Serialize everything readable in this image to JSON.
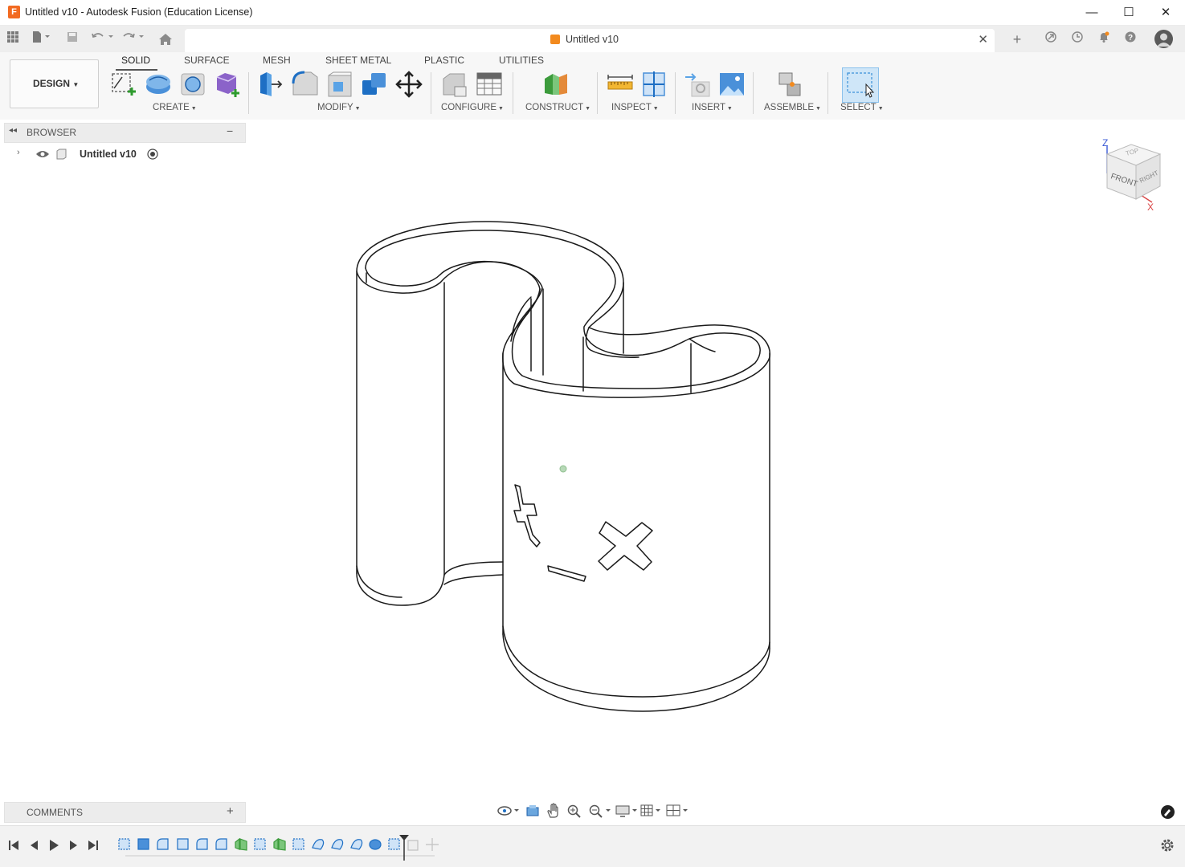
{
  "window": {
    "logo_letter": "F",
    "title": "Untitled v10 - Autodesk Fusion (Education License)",
    "minimize": "—",
    "maximize": "☐",
    "close": "✕"
  },
  "document_tab": {
    "label": "Untitled v10",
    "close": "✕"
  },
  "toolbar": {
    "workspace": "DESIGN",
    "tabs": [
      "SOLID",
      "SURFACE",
      "MESH",
      "SHEET METAL",
      "PLASTIC",
      "UTILITIES"
    ],
    "active_tab": "SOLID",
    "groups": [
      "CREATE",
      "MODIFY",
      "CONFIGURE",
      "CONSTRUCT",
      "INSPECT",
      "INSERT",
      "ASSEMBLE",
      "SELECT"
    ],
    "accent_blue": "#1e7bd6",
    "accent_orange": "#f28a1e"
  },
  "browser": {
    "title": "BROWSER",
    "collapse": "−",
    "root_item": "Untitled v10"
  },
  "comments": {
    "title": "COMMENTS",
    "add": "+"
  },
  "viewcube": {
    "front": "FRONT",
    "right": "RIGHT",
    "top": "TOP",
    "axis_z": "Z",
    "axis_x": "X"
  },
  "icons": {
    "app_menu": "grid-icon",
    "file": "file-icon",
    "save": "save-icon",
    "undo": "undo-icon",
    "redo": "redo-icon",
    "home": "home-icon",
    "new_tab": "plus-icon",
    "extensions": "extensions-icon",
    "job_status": "clock-icon",
    "notifications": "bell-icon",
    "help": "help-icon",
    "profile": "avatar"
  }
}
